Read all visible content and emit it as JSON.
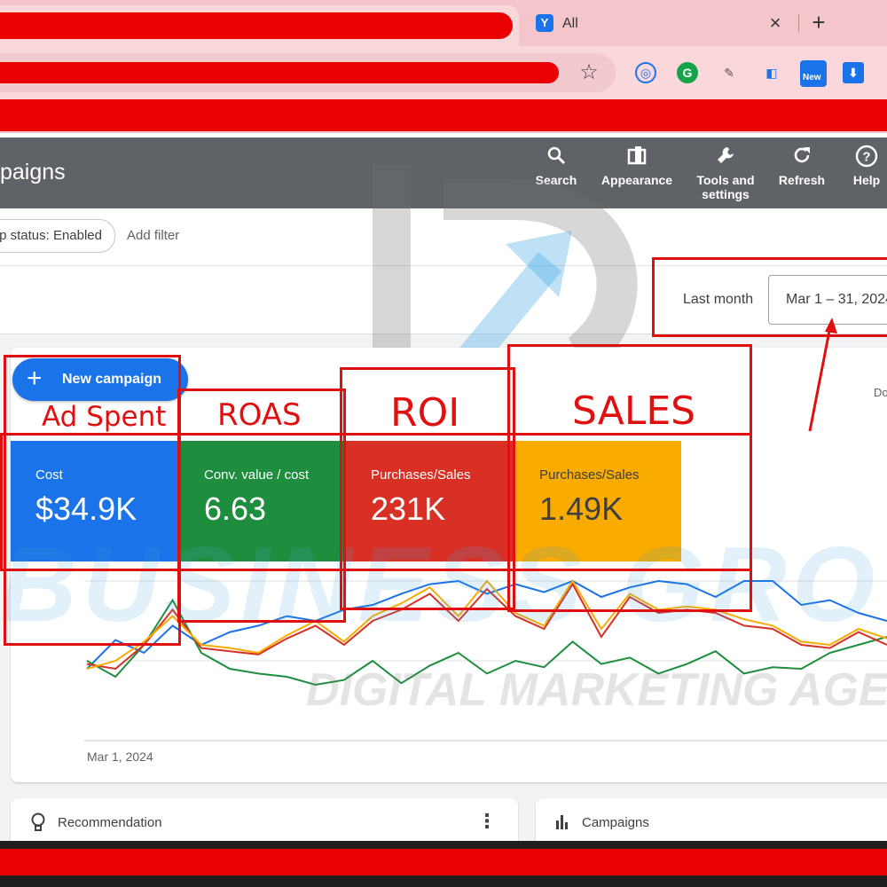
{
  "browser": {
    "tab_title": "All",
    "tab_close": "×",
    "new_tab": "+",
    "star_icon": "☆",
    "extensions": [
      "circle-extension-icon",
      "grammarly-icon",
      "pencil-extension-icon",
      "sidebar-extension-icon",
      "new-extension-icon",
      "download-extension-icon"
    ],
    "new_badge": "New"
  },
  "header": {
    "title": "paigns",
    "actions": [
      {
        "label": "Search",
        "icon": "search-icon"
      },
      {
        "label": "Appearance",
        "icon": "appearance-icon"
      },
      {
        "label": "Tools and settings",
        "icon": "wrench-icon"
      },
      {
        "label": "Refresh",
        "icon": "refresh-icon"
      },
      {
        "label": "Help",
        "icon": "help-icon"
      }
    ]
  },
  "filters": {
    "status_chip": "p status: Enabled",
    "add_filter": "Add filter"
  },
  "date": {
    "preset": "Last month",
    "range": "Mar 1 – 31, 2024"
  },
  "overview": {
    "new_campaign": "New campaign",
    "do_label": "Do",
    "metrics": [
      {
        "label": "Cost",
        "value": "$34.9K",
        "color": "#1a73e8"
      },
      {
        "label": "Conv. value / cost",
        "value": "6.63",
        "color": "#1e8e3e"
      },
      {
        "label": "Purchases/Sales",
        "value": "231K",
        "color": "#d93025"
      },
      {
        "label": "Purchases/Sales",
        "value": "1.49K",
        "color": "#f9ab00"
      }
    ],
    "x_tick": "Mar 1, 2024"
  },
  "annotations": {
    "ad_spent": "Ad Spent",
    "roas": "ROAS",
    "roi": "ROI",
    "sales": "SALES"
  },
  "watermark": {
    "big": "BUSINESS GROW",
    "sub": "DIGITAL MARKETING AGENCY"
  },
  "cards": {
    "recommendation": "Recommendation",
    "recommendation_menu": "⋮",
    "campaigns": "Campaigns"
  },
  "chart_data": {
    "type": "line",
    "series": [
      {
        "color": "#1a73e8",
        "values": [
          0.45,
          0.63,
          0.55,
          0.72,
          0.6,
          0.68,
          0.72,
          0.78,
          0.75,
          0.82,
          0.85,
          0.92,
          0.98,
          1.0,
          0.92,
          0.98,
          0.93,
          1.0,
          0.9,
          0.96,
          1.0,
          0.98,
          0.9,
          1.0,
          1.0,
          0.85,
          0.88,
          0.8,
          0.75
        ]
      },
      {
        "color": "#1e8e3e",
        "values": [
          0.5,
          0.4,
          0.6,
          0.88,
          0.55,
          0.45,
          0.42,
          0.4,
          0.35,
          0.38,
          0.5,
          0.36,
          0.47,
          0.55,
          0.42,
          0.5,
          0.46,
          0.62,
          0.48,
          0.52,
          0.42,
          0.48,
          0.56,
          0.42,
          0.46,
          0.45,
          0.55,
          0.6,
          0.65
        ]
      },
      {
        "color": "#d93025",
        "values": [
          0.48,
          0.45,
          0.6,
          0.82,
          0.58,
          0.56,
          0.54,
          0.64,
          0.72,
          0.6,
          0.75,
          0.82,
          0.92,
          0.75,
          0.95,
          0.78,
          0.7,
          0.98,
          0.65,
          0.9,
          0.8,
          0.82,
          0.8,
          0.72,
          0.7,
          0.6,
          0.58,
          0.68,
          0.6
        ]
      },
      {
        "color": "#f9ab00",
        "values": [
          0.45,
          0.5,
          0.62,
          0.78,
          0.6,
          0.58,
          0.55,
          0.66,
          0.75,
          0.62,
          0.78,
          0.86,
          0.96,
          0.78,
          1.0,
          0.8,
          0.72,
          1.0,
          0.7,
          0.92,
          0.82,
          0.84,
          0.82,
          0.76,
          0.72,
          0.62,
          0.6,
          0.7,
          0.64
        ]
      }
    ],
    "x_start_label": "Mar 1, 2024"
  }
}
